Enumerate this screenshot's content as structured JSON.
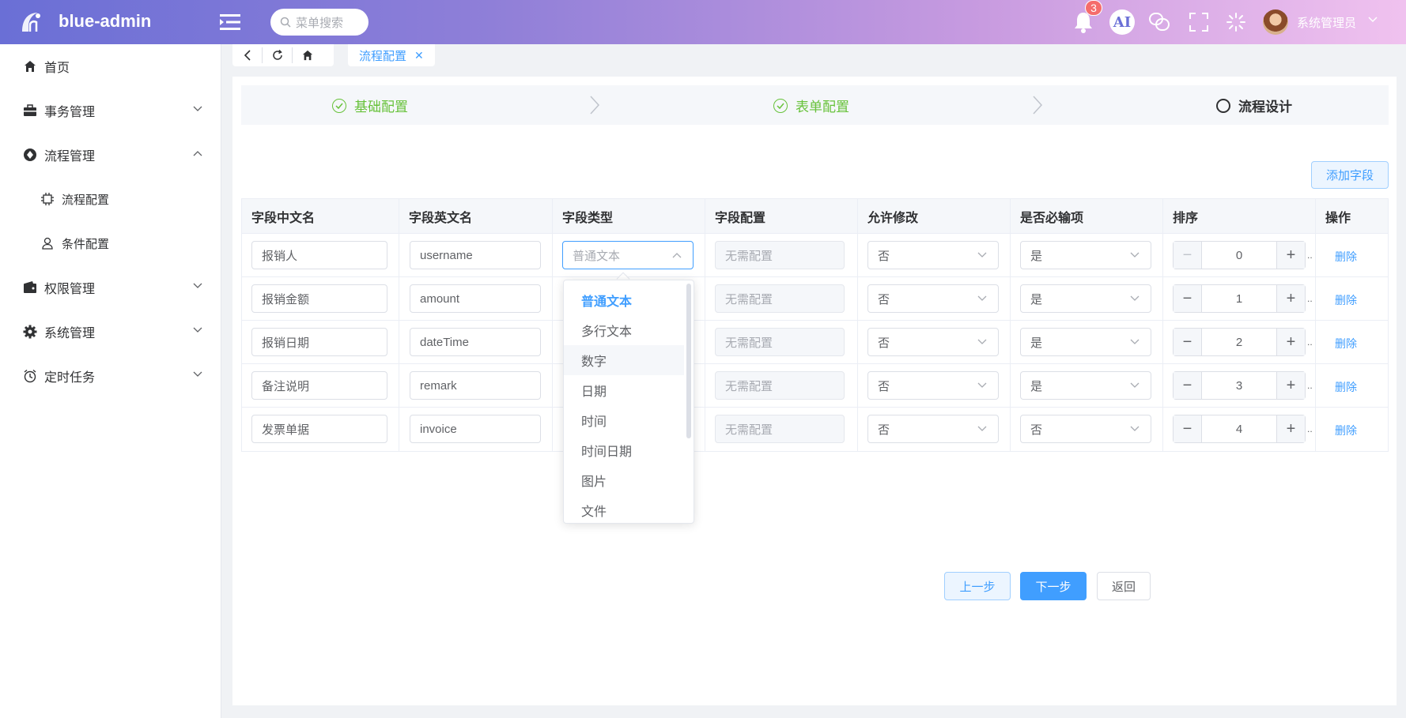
{
  "header": {
    "brand": "blue-admin",
    "search_placeholder": "菜单搜索",
    "notification_count": "3",
    "ai_label": "AI",
    "username": "系统管理员"
  },
  "sidebar": {
    "items": [
      {
        "label": "首页",
        "icon": "home-icon"
      },
      {
        "label": "事务管理",
        "icon": "briefcase-icon"
      },
      {
        "label": "流程管理",
        "icon": "process-icon",
        "expanded": true,
        "children": [
          {
            "label": "流程配置",
            "icon": "chip-icon"
          },
          {
            "label": "条件配置",
            "icon": "user-icon"
          }
        ]
      },
      {
        "label": "权限管理",
        "icon": "wallet-icon"
      },
      {
        "label": "系统管理",
        "icon": "gear-icon"
      },
      {
        "label": "定时任务",
        "icon": "alarm-icon"
      }
    ]
  },
  "tabs": {
    "active_label": "流程配置"
  },
  "steps": [
    {
      "label": "基础配置",
      "status": "done"
    },
    {
      "label": "表单配置",
      "status": "done"
    },
    {
      "label": "流程设计",
      "status": "current"
    }
  ],
  "add_field_label": "添加字段",
  "table": {
    "columns": [
      "字段中文名",
      "字段英文名",
      "字段类型",
      "字段配置",
      "允许修改",
      "是否必输项",
      "排序",
      "操作"
    ],
    "rows": [
      {
        "cn": "报销人",
        "en": "username",
        "type": "普通文本",
        "config": "无需配置",
        "editable": "否",
        "required": "是",
        "order": "0",
        "action": "删除"
      },
      {
        "cn": "报销金额",
        "en": "amount",
        "type": "",
        "config": "无需配置",
        "editable": "否",
        "required": "是",
        "order": "1",
        "action": "删除"
      },
      {
        "cn": "报销日期",
        "en": "dateTime",
        "type": "",
        "config": "无需配置",
        "editable": "否",
        "required": "是",
        "order": "2",
        "action": "删除"
      },
      {
        "cn": "备注说明",
        "en": "remark",
        "type": "",
        "config": "无需配置",
        "editable": "否",
        "required": "是",
        "order": "3",
        "action": "删除"
      },
      {
        "cn": "发票单据",
        "en": "invoice",
        "type": "",
        "config": "无需配置",
        "editable": "否",
        "required": "否",
        "order": "4",
        "action": "删除"
      }
    ]
  },
  "dropdown": {
    "options": [
      "普通文本",
      "多行文本",
      "数字",
      "日期",
      "时间",
      "时间日期",
      "图片",
      "文件"
    ],
    "selected": "普通文本",
    "hovered": "数字"
  },
  "footer": {
    "prev_label": "上一步",
    "next_label": "下一步",
    "back_label": "返回"
  },
  "colors": {
    "primary": "#409eff",
    "success": "#67c23a",
    "header_gradient_start": "#6a6fd6",
    "header_gradient_end": "#f0c2ef"
  }
}
